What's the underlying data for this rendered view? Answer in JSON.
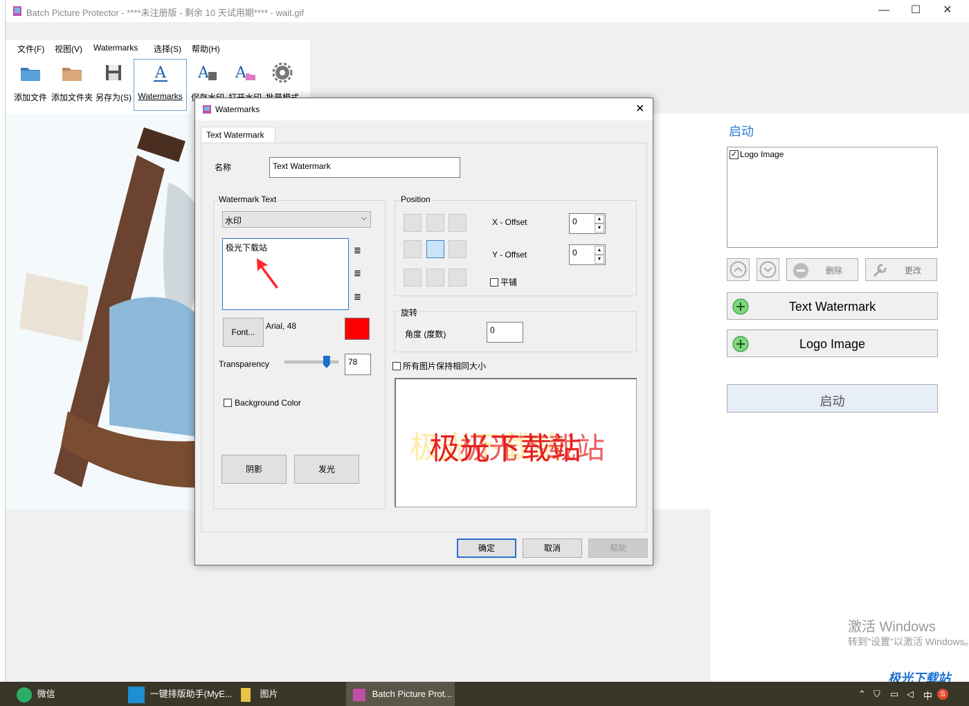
{
  "window": {
    "title": "Batch Picture Protector - ****未注册版 - 剩余 10 天试用期**** - wait.gif"
  },
  "menu": [
    "文件(F)",
    "视图(V)",
    "Watermarks",
    "选择(S)",
    "帮助(H)"
  ],
  "toolbar": [
    "添加文件",
    "添加文件夹",
    "另存为(S)",
    "Watermarks",
    "保存水印",
    "打开水印",
    "批量模式"
  ],
  "right_panel": {
    "heading": "启动",
    "list_item": "Logo Image",
    "delete_label": "删除",
    "edit_label": "更改",
    "add_text_label": "Text Watermark",
    "add_logo_label": "Logo Image",
    "start_label": "启动"
  },
  "dialog": {
    "title": "Watermarks",
    "tab": "Text Watermark",
    "name_label": "名称",
    "name_value": "Text Watermark",
    "text_group": "Watermark Text",
    "text_select": "水印",
    "text_value": "极光下载站",
    "font_button": "Font...",
    "font_info": "Arial, 48",
    "font_color": "#ff0000",
    "transparency_label": "Transparency",
    "transparency_value": "78",
    "bg_color_label": "Background Color",
    "shadow_button": "阴影",
    "glow_button": "发光",
    "position_group": "Position",
    "x_offset_label": "X - Offset",
    "x_offset_value": "0",
    "y_offset_label": "Y - Offset",
    "y_offset_value": "0",
    "tile_label": "平铺",
    "rotation_group": "旋转",
    "angle_label": "角度 (度数)",
    "angle_value": "0",
    "same_size_label": "所有图片保持相同大小",
    "preview_text": "极光下载站",
    "ok_button": "确定",
    "cancel_button": "取消",
    "help_button": "帮助"
  },
  "activation": {
    "title": "激活 Windows",
    "subtitle": "转到\"设置\"以激活 Windows。"
  },
  "taskbar": {
    "items": [
      "微信",
      "一键排版助手(MyE...",
      "图片",
      "Batch Picture Prot..."
    ],
    "ime": "中"
  },
  "site_logo": "极光下载站"
}
